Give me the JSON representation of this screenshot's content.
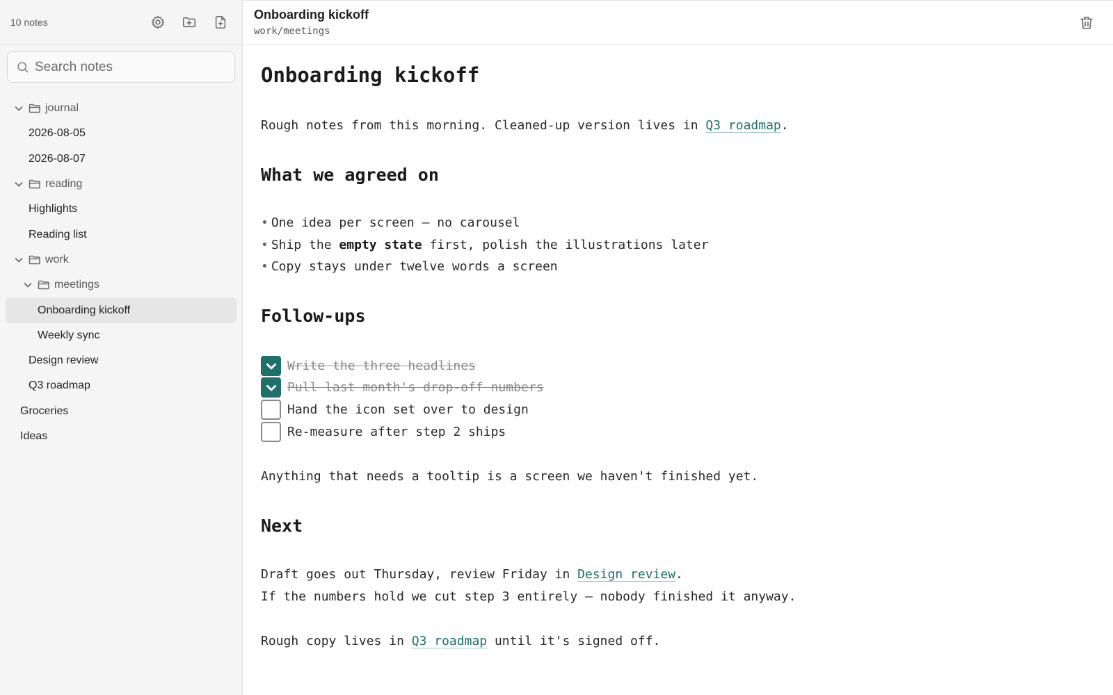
{
  "sidebar": {
    "note_count": "10 notes",
    "icons": {
      "settings": "gear-icon",
      "new_folder": "folder-plus-icon",
      "new_note": "file-plus-icon"
    },
    "search": {
      "placeholder": "Search notes",
      "value": ""
    },
    "tree": {
      "journal": "journal",
      "journal_1": "2026-08-05",
      "journal_2": "2026-08-07",
      "reading": "reading",
      "reading_1": "Highlights",
      "reading_2": "Reading list",
      "work": "work",
      "meetings": "meetings",
      "meetings_1": "Onboarding kickoff",
      "meetings_2": "Weekly sync",
      "work_1": "Design review",
      "work_2": "Q3 roadmap",
      "root_1": "Groceries",
      "root_2": "Ideas"
    }
  },
  "header": {
    "title": "Onboarding kickoff",
    "path": "work/meetings",
    "trash_icon": "trash-icon"
  },
  "doc": {
    "title": "Onboarding kickoff",
    "intro_pre": "Rough notes from this morning. Cleaned-up version lives in ",
    "intro_link": "Q3 roadmap",
    "intro_post": ".",
    "h_agreed": "What we agreed on",
    "b1": "One idea per screen — no carousel",
    "b2_pre": "Ship the ",
    "b2_bold": "empty state",
    "b2_post": " first, polish the illustrations later",
    "b3": "Copy stays under twelve words a screen",
    "h_followups": "Follow-ups",
    "tasks": [
      {
        "label": "Write the three headlines",
        "done": true
      },
      {
        "label": "Pull last month's drop-off numbers",
        "done": true
      },
      {
        "label": "Hand the icon set over to design",
        "done": false
      },
      {
        "label": "Re-measure after step 2 ships",
        "done": false
      }
    ],
    "tooltip_line": "Anything that needs a tooltip is a screen we haven't finished yet.",
    "h_next": "Next",
    "next1_pre": "Draft goes out Thursday, review Friday in ",
    "next1_link": "Design review",
    "next1_post": ".",
    "next2": "If the numbers hold we cut step 3 entirely — nobody finished it anyway.",
    "next3_pre": "Rough copy lives in ",
    "next3_link": "Q3 roadmap",
    "next3_post": " until it's signed off."
  },
  "colors": {
    "accent": "#1f6f6a",
    "sidebar_bg": "#f5f5f5",
    "active_row": "#e6e6e6"
  }
}
